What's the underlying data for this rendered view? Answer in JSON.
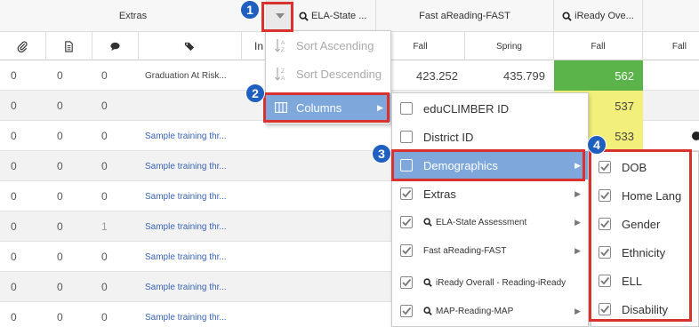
{
  "header": {
    "extras_label": "Extras",
    "ela_state_label": "ELA-State ...",
    "fast_label": "Fast aReading-FAST",
    "iready_label": "iReady Ove...",
    "sub_in": "In",
    "sub_fall_1": "Fall",
    "sub_spring": "Spring",
    "sub_fall_2": "Fall",
    "sub_fall_3": "Fall"
  },
  "rows": [
    {
      "c1": "0",
      "c2": "0",
      "c3": "0",
      "desc": "Graduation At Risk...",
      "fall": "423.252",
      "spring": "435.799",
      "score": "562",
      "score_color": "#5ab44a"
    },
    {
      "c1": "0",
      "c2": "0",
      "c3": "0",
      "desc": "",
      "score": "537",
      "score_color": "#f2f07a"
    },
    {
      "c1": "0",
      "c2": "0",
      "c3": "0",
      "desc": "Sample training thr...",
      "score": "533",
      "score_color": "#f2f07a"
    },
    {
      "c1": "0",
      "c2": "0",
      "c3": "0",
      "desc": "Sample training thr..."
    },
    {
      "c1": "0",
      "c2": "0",
      "c3": "0",
      "desc": "Sample training thr..."
    },
    {
      "c1": "0",
      "c2": "0",
      "c3": "1",
      "desc": "Sample training thr..."
    },
    {
      "c1": "0",
      "c2": "0",
      "c3": "0",
      "desc": "Sample training thr..."
    },
    {
      "c1": "0",
      "c2": "0",
      "c3": "0",
      "desc": "Sample training thr..."
    },
    {
      "c1": "0",
      "c2": "0",
      "c3": "0",
      "desc": "Sample training thr..."
    }
  ],
  "menu1": {
    "sort_asc": "Sort Ascending",
    "sort_desc": "Sort Descending",
    "columns": "Columns"
  },
  "menu2": {
    "items": [
      {
        "label": "eduCLIMBER ID",
        "checked": false
      },
      {
        "label": "District ID",
        "checked": false
      },
      {
        "label": "Demographics",
        "checked": false
      },
      {
        "label": "Extras",
        "checked": true
      },
      {
        "label": "ELA-State Assessment",
        "checked": true
      },
      {
        "label": "Fast aReading-FAST",
        "checked": true
      },
      {
        "label": "iReady Overall - Reading-iReady",
        "checked": true
      },
      {
        "label": "MAP-Reading-MAP",
        "checked": true
      }
    ]
  },
  "menu3": {
    "items": [
      "DOB",
      "Home Lang",
      "Gender",
      "Ethnicity",
      "ELL",
      "Disability"
    ]
  },
  "badges": [
    "1",
    "2",
    "3",
    "4"
  ],
  "colors": {
    "accent_blue": "#7ea7dc",
    "annotation_red": "#d9322e",
    "badge_blue": "#1f5fbf",
    "score_green": "#5ab44a",
    "score_yellow": "#f2f07a"
  }
}
